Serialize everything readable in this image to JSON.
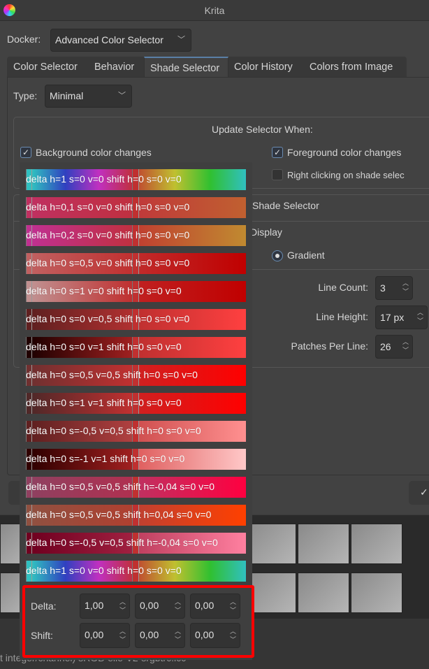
{
  "window": {
    "title": "Krita"
  },
  "docker": {
    "label": "Docker:",
    "value": "Advanced Color Selector"
  },
  "tabs": [
    {
      "label": "Color Selector"
    },
    {
      "label": "Behavior"
    },
    {
      "label": "Shade Selector",
      "active": true
    },
    {
      "label": "Color History"
    },
    {
      "label": "Colors from Image"
    }
  ],
  "type": {
    "label": "Type:",
    "value": "Minimal"
  },
  "update": {
    "title": "Update Selector When:",
    "background": {
      "label": "Background color changes",
      "checked": true
    },
    "foreground": {
      "label": "Foreground color changes",
      "checked": true
    },
    "right_click": {
      "label": "Right clicking on shade selec",
      "checked": false
    }
  },
  "shade": {
    "title": "Shade Selector",
    "display": "Display",
    "gradient": "Gradient",
    "line_count": {
      "label": "Line Count:",
      "value": "3"
    },
    "line_height": {
      "label": "Line Height:",
      "value": "17 px"
    },
    "patches": {
      "label": "Patches Per Line:",
      "value": "26"
    }
  },
  "presets_list": [
    {
      "label": "delta h=1 s=0 v=0 shift h=0 s=0 v=0",
      "swatch": "#30c0c0",
      "left": [
        "#30c0c0",
        "#3040c0",
        "#c030c0",
        "#c03040"
      ],
      "right": [
        "#c05030",
        "#c0c030",
        "#30c030",
        "#30c0c0"
      ]
    },
    {
      "label": "delta h=0,1 s=0 v=0 shift h=0 s=0 v=0",
      "swatch": "#c03060",
      "left": [
        "#c03060",
        "#c03040"
      ],
      "right": [
        "#c03a3a",
        "#c06030"
      ]
    },
    {
      "label": "delta h=0,2 s=0 v=0 shift h=0 s=0 v=0",
      "swatch": "#c03090",
      "left": [
        "#c03090",
        "#c03040"
      ],
      "right": [
        "#c04030",
        "#c08a30"
      ]
    },
    {
      "label": "delta h=0 s=0,5 v=0 shift h=0 s=0 v=0",
      "swatch": "#c06060",
      "left": [
        "#c06060",
        "#c03030"
      ],
      "right": [
        "#c02a2a",
        "#c00000"
      ]
    },
    {
      "label": "delta h=0 s=1 v=0 shift h=0 s=0 v=0",
      "swatch": "#c09090",
      "left": [
        "#c09090",
        "#c03030"
      ],
      "right": [
        "#c02020",
        "#c00000"
      ]
    },
    {
      "label": "delta h=0 s=0 v=0,5 shift h=0 s=0 v=0",
      "swatch": "#602020",
      "left": [
        "#602020",
        "#b03030"
      ],
      "right": [
        "#c03030",
        "#ff4040"
      ]
    },
    {
      "label": "delta h=0 s=0 v=1 shift h=0 s=0 v=0",
      "swatch": "#200000",
      "left": [
        "#200000",
        "#a02020"
      ],
      "right": [
        "#c03030",
        "#ff4040"
      ]
    },
    {
      "label": "delta h=0 s=0,5 v=0,5 shift h=0 s=0 v=0",
      "swatch": "#703030",
      "left": [
        "#703030",
        "#c03030"
      ],
      "right": [
        "#d02020",
        "#ff0000"
      ]
    },
    {
      "label": "delta h=0 s=1 v=1 shift h=0 s=0 v=0",
      "swatch": "#502828",
      "left": [
        "#502828",
        "#c03030"
      ],
      "right": [
        "#d02020",
        "#ff0000"
      ]
    },
    {
      "label": "delta h=0 s=-0,5 v=0,5 shift h=0 s=0 v=0",
      "swatch": "#602020",
      "left": [
        "#602020",
        "#b04040"
      ],
      "right": [
        "#d05050",
        "#ff9090"
      ]
    },
    {
      "label": "delta h=0 s=-1 v=1 shift h=0 s=0 v=0",
      "swatch": "#300000",
      "left": [
        "#300000",
        "#a02020"
      ],
      "right": [
        "#e06060",
        "#ffc8c8"
      ]
    },
    {
      "label": "delta h=0 s=0,5 v=0,5 shift h=-0,04 s=0 v=0",
      "swatch": "#904060",
      "left": [
        "#904060",
        "#b03050"
      ],
      "right": [
        "#c03060",
        "#ff0040"
      ]
    },
    {
      "label": "delta h=0 s=0,5 v=0,5 shift h=0,04 s=0 v=0",
      "swatch": "#905040",
      "left": [
        "#905040",
        "#b04030"
      ],
      "right": [
        "#c04030",
        "#ff4000"
      ]
    },
    {
      "label": "delta h=0 s=-0,5 v=0,5 shift h=-0,04 s=0 v=0",
      "swatch": "#700020",
      "left": [
        "#700020",
        "#a02040"
      ],
      "right": [
        "#c04060",
        "#ff80a0"
      ]
    },
    {
      "label": "delta h=1 s=0 v=0 shift h=0 s=0 v=0",
      "swatch": "#30c0c0",
      "left": [
        "#30c0c0",
        "#3040c0",
        "#c030c0",
        "#c03040"
      ],
      "right": [
        "#c05030",
        "#c0c030",
        "#30c030",
        "#30c0c0"
      ]
    }
  ],
  "params": {
    "delta_label": "Delta:",
    "shift_label": "Shift:",
    "delta": [
      "1,00",
      "0,00",
      "0,00"
    ],
    "shift": [
      "0,00",
      "0,00",
      "0,00"
    ]
  },
  "status": {
    "text": "t integer/channel)  sRGB-elle-V2-srgbtrc.icc"
  },
  "colors": {
    "highlight": "#ff0000",
    "accent": "#5a7fa6"
  }
}
